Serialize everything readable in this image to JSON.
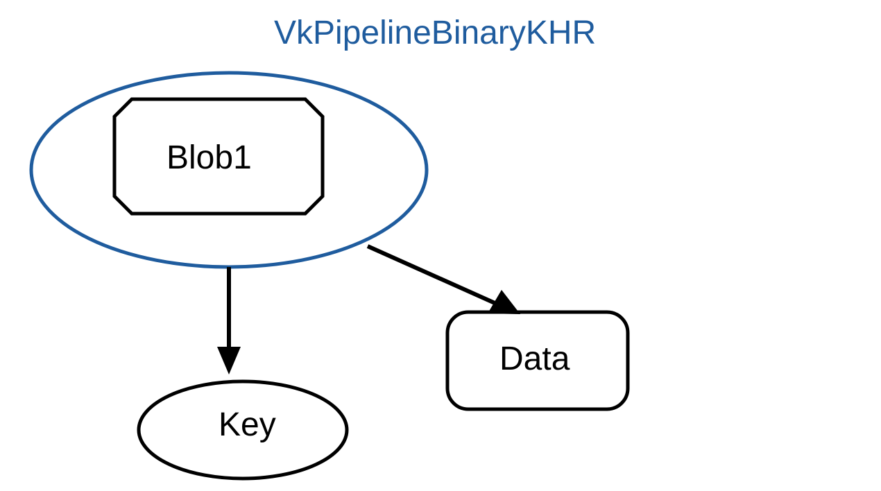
{
  "diagram": {
    "title": "VkPipelineBinaryKHR",
    "nodes": {
      "blob": {
        "label": "Blob1"
      },
      "key": {
        "label": "Key"
      },
      "data": {
        "label": "Data"
      }
    },
    "colors": {
      "title": "#1f5c9e",
      "ellipse_stroke": "#1f5c9e",
      "node_stroke": "#000000"
    }
  }
}
